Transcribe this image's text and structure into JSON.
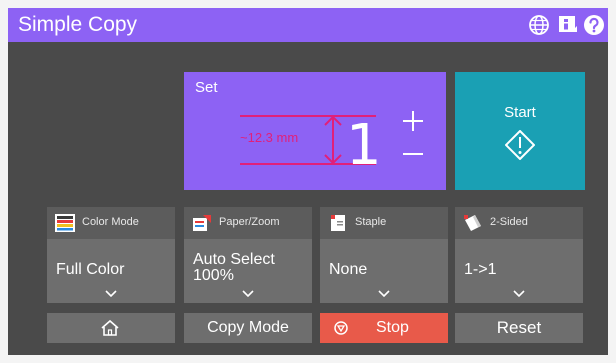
{
  "header": {
    "title": "Simple Copy",
    "icons": [
      "globe-icon",
      "info-icon",
      "help-icon"
    ]
  },
  "set_panel": {
    "label": "Set",
    "count": "1",
    "measurement": "~12.3 mm"
  },
  "start": {
    "label": "Start"
  },
  "functions": [
    {
      "label": "Color Mode",
      "value_line1": "Full Color",
      "value_line2": ""
    },
    {
      "label": "Paper/Zoom",
      "value_line1": "Auto Select",
      "value_line2": "100%"
    },
    {
      "label": "Staple",
      "value_line1": "None",
      "value_line2": ""
    },
    {
      "label": "2-Sided",
      "value_line1": "1->1",
      "value_line2": ""
    }
  ],
  "bottom": {
    "copy_mode_label": "Copy Mode",
    "stop_label": "Stop",
    "reset_label": "Reset"
  },
  "colors": {
    "accent": "#8d62f4",
    "start": "#1aa0b4",
    "stop": "#e85a4a",
    "measure": "#e0207a"
  }
}
